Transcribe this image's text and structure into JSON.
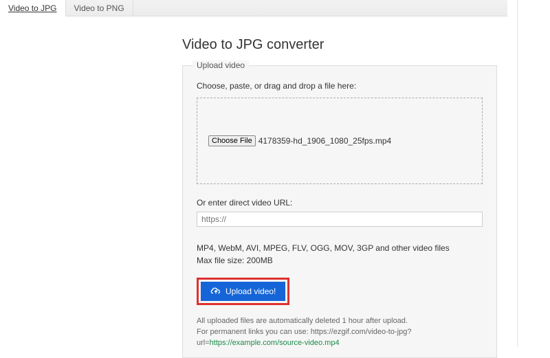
{
  "tabs": {
    "active": "Video to JPG",
    "inactive": "Video to PNG"
  },
  "title": "Video to JPG converter",
  "upload": {
    "legend": "Upload video",
    "instruction": "Choose, paste, or drag and drop a file here:",
    "choose_label": "Choose File",
    "filename": "4178359-hd_1906_1080_25fps.mp4",
    "or_label": "Or enter direct video URL:",
    "url_placeholder": "https://",
    "formats_line": "MP4, WebM, AVI, MPEG, FLV, OGG, MOV, 3GP and other video files",
    "maxsize_line": "Max file size: 200MB",
    "button_label": "Upload video!",
    "foot_line1": "All uploaded files are automatically deleted 1 hour after upload.",
    "foot_line2a": "For permanent links you can use: https://ezgif.com/video-to-jpg?",
    "foot_line2b": "url=",
    "foot_link": "https://example.com/source-video.mp4"
  }
}
